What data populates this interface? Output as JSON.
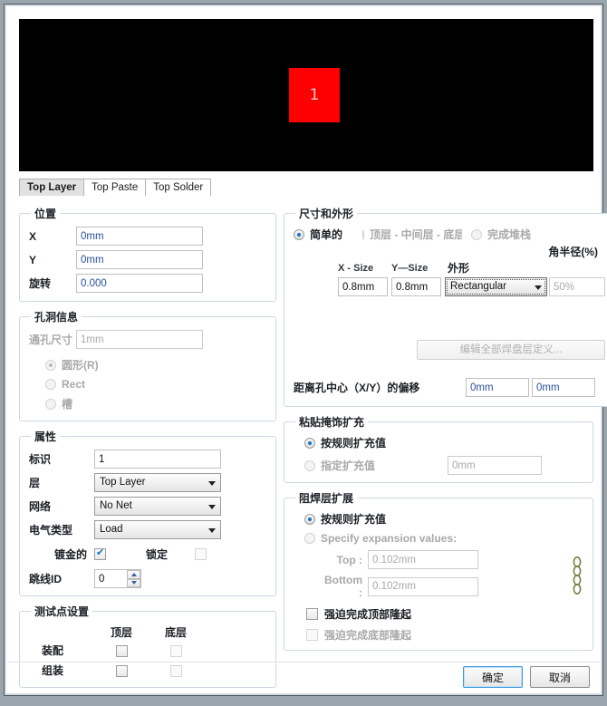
{
  "preview": {
    "pad_label": "1",
    "pad_color": "#ff0000",
    "background": "#000000"
  },
  "tabs": [
    {
      "label": "Top Layer",
      "active": true
    },
    {
      "label": "Top Paste",
      "active": false
    },
    {
      "label": "Top Solder",
      "active": false
    }
  ],
  "location": {
    "title": "位置",
    "x_label": "X",
    "x_value": "0mm",
    "y_label": "Y",
    "y_value": "0mm",
    "rotation_label": "旋转",
    "rotation_value": "0.000"
  },
  "hole": {
    "title": "孔洞信息",
    "size_label": "通孔尺寸",
    "size_value": "1mm",
    "shape_round": "圆形(R)",
    "shape_rect": "Rect",
    "shape_slot": "槽"
  },
  "properties": {
    "title": "属性",
    "designator_label": "标识",
    "designator_value": "1",
    "layer_label": "层",
    "layer_value": "Top Layer",
    "net_label": "网络",
    "net_value": "No Net",
    "electrical_label": "电气类型",
    "electrical_value": "Load",
    "plated_label": "镀金的",
    "plated_checked": true,
    "locked_label": "锁定",
    "locked_checked": false,
    "jumper_label": "跳线ID",
    "jumper_value": "0"
  },
  "testpoint": {
    "title": "测试点设置",
    "col_top": "顶层",
    "col_bottom": "底层",
    "rows": [
      {
        "label": "装配",
        "top": false,
        "bottom": false
      },
      {
        "label": "组装",
        "top": false,
        "bottom": false
      }
    ]
  },
  "size_shape": {
    "title": "尺寸和外形",
    "mode_simple": "简单的",
    "mode_tml": "顶层 - 中间层 - 底层",
    "mode_full": "完成堆栈",
    "corner_radius_label": "角半径(%)",
    "x_size_label": "X - Size",
    "x_size_value": "0.8mm",
    "y_size_label": "Y—Size",
    "y_size_value": "0.8mm",
    "shape_label": "外形",
    "shape_value": "Rectangular",
    "corner_radius_value": "50%",
    "edit_all_button": "编辑全部焊盘层定义...",
    "offset_label": "距离孔中心（X/Y）的偏移",
    "offset_x": "0mm",
    "offset_y": "0mm"
  },
  "paste_mask": {
    "title": "粘贴掩饰扩充",
    "rule_label": "按规则扩充值",
    "specify_label": "指定扩充值",
    "specify_value": "0mm"
  },
  "solder_mask": {
    "title": "阻焊层扩展",
    "rule_label": "按规则扩充值",
    "specify_label": "Specify expansion values:",
    "top_label": "Top :",
    "top_value": "0.102mm",
    "bottom_label": "Bottom :",
    "bottom_value": "0.102mm",
    "force_top_label": "强迫完成顶部隆起",
    "force_bottom_label": "强迫完成底部隆起"
  },
  "footer": {
    "ok": "确定",
    "cancel": "取消"
  }
}
